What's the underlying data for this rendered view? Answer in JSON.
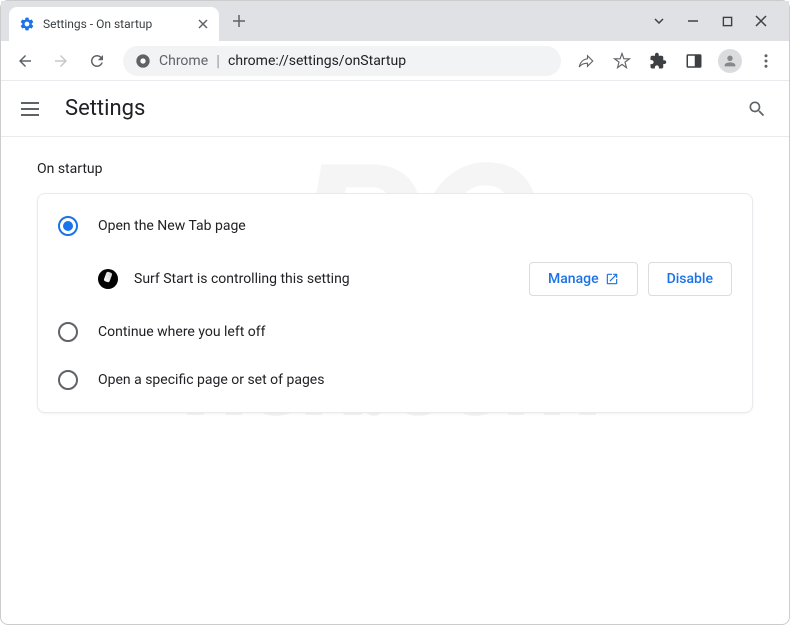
{
  "window": {
    "tab_title": "Settings - On startup"
  },
  "toolbar": {
    "chrome_label": "Chrome",
    "url": "chrome://settings/onStartup"
  },
  "header": {
    "title": "Settings"
  },
  "section": {
    "title": "On startup"
  },
  "options": {
    "open_new_tab": "Open the New Tab page",
    "continue": "Continue where you left off",
    "specific": "Open a specific page or set of pages"
  },
  "extension_control": {
    "text": "Surf Start is controlling this setting",
    "manage": "Manage",
    "disable": "Disable"
  },
  "watermark": {
    "top": "PC",
    "bottom": "risk.com"
  }
}
